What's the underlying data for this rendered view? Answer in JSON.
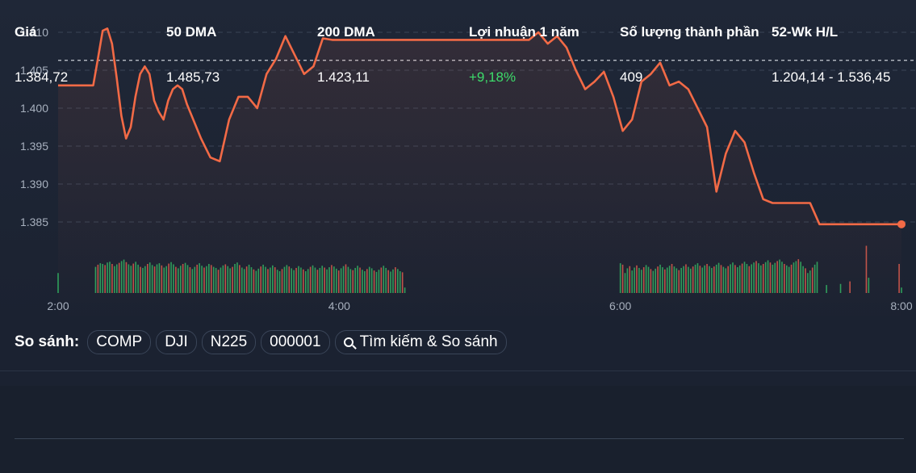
{
  "chart_data": {
    "type": "line",
    "y_ticks": [
      "1.410",
      "1.405",
      "1.400",
      "1.395",
      "1.390",
      "1.385"
    ],
    "x_ticks": [
      "2:00",
      "4:00",
      "6:00",
      "8:00"
    ],
    "ylim": [
      1383.5,
      1410.8
    ],
    "xlim": [
      120,
      480
    ],
    "reference_line": 1406.3,
    "grid": true,
    "line_color": "#f26a46",
    "series": [
      {
        "x": [
          120,
          135,
          137,
          139,
          141,
          143,
          145,
          147,
          149,
          151,
          153,
          155,
          157,
          159,
          161,
          163,
          165,
          167,
          169,
          171,
          173,
          175,
          177,
          179,
          181,
          185,
          189,
          193,
          197,
          201,
          205,
          209,
          213,
          217,
          221,
          225,
          229,
          233,
          237,
          241,
          245,
          249,
          253,
          257,
          261,
          265,
          269,
          273,
          277,
          281,
          285,
          289,
          293,
          297,
          301,
          305,
          309,
          313,
          317,
          321,
          325,
          329,
          333,
          337,
          341,
          345,
          349,
          353,
          357,
          361,
          365,
          369,
          373,
          377,
          381,
          385,
          389,
          393,
          397,
          401,
          405,
          409,
          413,
          417,
          421,
          425,
          429,
          433,
          437,
          441,
          445,
          449,
          453,
          457,
          461,
          465,
          469,
          473,
          477,
          480
        ],
        "values": [
          1403.0,
          1403.0,
          1406.5,
          1410.2,
          1410.5,
          1408.5,
          1404.0,
          1399.0,
          1396.0,
          1397.5,
          1401.5,
          1404.5,
          1405.5,
          1404.5,
          1401.0,
          1399.5,
          1398.5,
          1401.0,
          1402.5,
          1403.0,
          1402.5,
          1400.5,
          1399.0,
          1397.5,
          1396.0,
          1393.5,
          1393.0,
          1398.5,
          1401.5,
          1401.5,
          1400.0,
          1404.5,
          1406.5,
          1409.5,
          1407.0,
          1404.5,
          1405.5,
          1409.2,
          1409.0,
          1409.0,
          1409.0,
          1409.0,
          1409.0,
          1409.0,
          1409.0,
          1409.0,
          1409.0,
          1409.0,
          1409.0,
          1409.0,
          1409.0,
          1409.0,
          1409.0,
          1409.0,
          1409.0,
          1409.0,
          1409.0,
          1409.0,
          1409.0,
          1409.0,
          1410.0,
          1408.5,
          1409.5,
          1408.0,
          1405.0,
          1402.5,
          1403.5,
          1404.8,
          1401.5,
          1397.0,
          1398.5,
          1403.5,
          1404.5,
          1406.0,
          1403.0,
          1403.5,
          1402.5,
          1400.0,
          1397.5,
          1389.0,
          1394.0,
          1397.0,
          1395.5,
          1391.5,
          1388.0,
          1387.5,
          1387.5,
          1387.5,
          1387.5,
          1387.5,
          1384.7,
          1384.7,
          1384.7,
          1384.7,
          1384.7,
          1384.7,
          1384.7,
          1384.7,
          1384.7,
          1384.7
        ]
      }
    ],
    "volume": {
      "segments": [
        {
          "start": 120,
          "end": 120,
          "values": [
            0.55
          ]
        },
        {
          "start": 136,
          "end": 268,
          "values": [
            0.72,
            0.78,
            0.82,
            0.8,
            0.77,
            0.84,
            0.86,
            0.8,
            0.74,
            0.79,
            0.83,
            0.88,
            0.92,
            0.85,
            0.79,
            0.75,
            0.81,
            0.86,
            0.78,
            0.72,
            0.69,
            0.74,
            0.8,
            0.84,
            0.77,
            0.73,
            0.79,
            0.82,
            0.76,
            0.7,
            0.74,
            0.81,
            0.85,
            0.79,
            0.72,
            0.68,
            0.75,
            0.8,
            0.83,
            0.77,
            0.71,
            0.66,
            0.72,
            0.78,
            0.82,
            0.75,
            0.7,
            0.74,
            0.8,
            0.77,
            0.72,
            0.69,
            0.64,
            0.7,
            0.76,
            0.79,
            0.74,
            0.68,
            0.72,
            0.8,
            0.84,
            0.77,
            0.7,
            0.66,
            0.73,
            0.78,
            0.71,
            0.65,
            0.61,
            0.67,
            0.73,
            0.78,
            0.72,
            0.66,
            0.7,
            0.76,
            0.71,
            0.64,
            0.6,
            0.66,
            0.72,
            0.77,
            0.73,
            0.68,
            0.63,
            0.69,
            0.74,
            0.7,
            0.65,
            0.6,
            0.66,
            0.72,
            0.76,
            0.7,
            0.64,
            0.69,
            0.75,
            0.7,
            0.65,
            0.71,
            0.77,
            0.73,
            0.67,
            0.62,
            0.68,
            0.74,
            0.79,
            0.72,
            0.66,
            0.63,
            0.69,
            0.75,
            0.7,
            0.64,
            0.6,
            0.66,
            0.72,
            0.68,
            0.62,
            0.58,
            0.64,
            0.7,
            0.75,
            0.69,
            0.63,
            0.59,
            0.65,
            0.71,
            0.66,
            0.6,
            0.57,
            0.15
          ]
        },
        {
          "start": 360,
          "end": 444,
          "values": [
            0.82,
            0.78,
            0.55,
            0.68,
            0.74,
            0.62,
            0.7,
            0.76,
            0.69,
            0.64,
            0.71,
            0.77,
            0.72,
            0.66,
            0.61,
            0.67,
            0.73,
            0.78,
            0.71,
            0.65,
            0.7,
            0.75,
            0.8,
            0.73,
            0.68,
            0.63,
            0.69,
            0.74,
            0.79,
            0.72,
            0.67,
            0.73,
            0.78,
            0.82,
            0.75,
            0.7,
            0.76,
            0.8,
            0.74,
            0.69,
            0.73,
            0.78,
            0.83,
            0.77,
            0.72,
            0.68,
            0.74,
            0.79,
            0.84,
            0.77,
            0.71,
            0.76,
            0.81,
            0.86,
            0.8,
            0.74,
            0.79,
            0.84,
            0.88,
            0.82,
            0.76,
            0.8,
            0.85,
            0.9,
            0.84,
            0.78,
            0.83,
            0.88,
            0.92,
            0.86,
            0.8,
            0.76,
            0.72,
            0.78,
            0.84,
            0.88,
            0.93,
            0.86,
            0.74,
            0.68,
            0.55,
            0.62,
            0.7,
            0.78,
            0.86
          ]
        },
        {
          "start": 448,
          "end": 480,
          "values": [
            0.22,
            0.0,
            0.0,
            0.0,
            0.0,
            0.0,
            0.25,
            0.0,
            0.0,
            0.0,
            0.32,
            0.0,
            0.0,
            0.0,
            0.0,
            0.0,
            0.0,
            1.3,
            0.42,
            0.0,
            0.0,
            0.0,
            0.0,
            0.0,
            0.0,
            0.0,
            0.0,
            0.0,
            0.0,
            0.0,
            0.0,
            0.8,
            0.15
          ]
        }
      ]
    },
    "volume_colors": {
      "up": "#2e9f5c",
      "down": "#c0534a"
    }
  },
  "compare": {
    "label": "So sánh:",
    "chips": [
      "COMP",
      "DJI",
      "N225",
      "000001"
    ],
    "search_label": "Tìm kiếm & So sánh",
    "search_icon": "search-icon"
  },
  "stats": {
    "headers": [
      "Giá",
      "50 DMA",
      "200 DMA",
      "Lợi nhuận 1 năm",
      "Số lượng thành phần",
      "52-Wk H/L"
    ],
    "values": [
      "1.384,72",
      "1.485,73",
      "1.423,11",
      "+9,18%",
      "409",
      "1.204,14 - 1.536,45"
    ],
    "positive_color": "#3ddc6b"
  }
}
